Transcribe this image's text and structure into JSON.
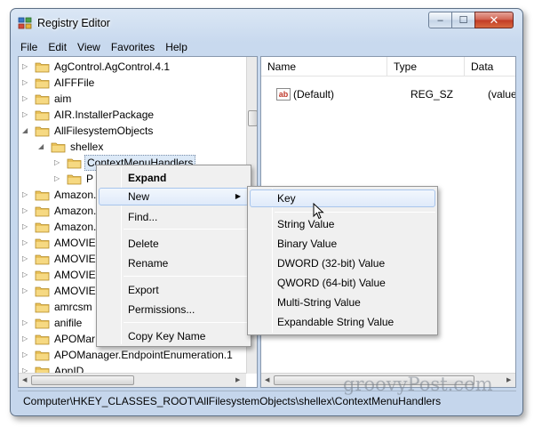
{
  "window": {
    "title": "Registry Editor",
    "min_symbol": "–",
    "max_symbol": "☐",
    "close_symbol": "✕"
  },
  "menubar": [
    "File",
    "Edit",
    "View",
    "Favorites",
    "Help"
  ],
  "tree": {
    "items": [
      {
        "label": "AgControl.AgControl.4.1",
        "expanded": false
      },
      {
        "label": "AIFFFile",
        "expanded": false
      },
      {
        "label": "aim",
        "expanded": false
      },
      {
        "label": "AIR.InstallerPackage",
        "expanded": false
      },
      {
        "label": "AllFilesystemObjects",
        "expanded": true
      },
      {
        "label": "shellex",
        "expanded": true
      },
      {
        "label": "ContextMenuHandlers",
        "selected": true
      },
      {
        "label": "P"
      },
      {
        "label": "Amazon."
      },
      {
        "label": "Amazon."
      },
      {
        "label": "Amazon."
      },
      {
        "label": "AMOVIE."
      },
      {
        "label": "AMOVIE."
      },
      {
        "label": "AMOVIE."
      },
      {
        "label": "AMOVIE."
      },
      {
        "label": "amrcsm"
      },
      {
        "label": "anifile"
      },
      {
        "label": "APOMar"
      },
      {
        "label": "APOManager.EndpointEnumeration.1"
      },
      {
        "label": "AppID"
      }
    ]
  },
  "list": {
    "columns": [
      "Name",
      "Type",
      "Data"
    ],
    "rows": [
      {
        "name": "(Default)",
        "type": "REG_SZ",
        "data": "(value n"
      }
    ]
  },
  "context_menu": {
    "items": [
      "Expand",
      "New",
      "Find...",
      "Delete",
      "Rename",
      "Export",
      "Permissions...",
      "Copy Key Name"
    ]
  },
  "submenu": {
    "items": [
      "Key",
      "String Value",
      "Binary Value",
      "DWORD (32-bit) Value",
      "QWORD (64-bit) Value",
      "Multi-String Value",
      "Expandable String Value"
    ]
  },
  "statusbar": {
    "path": "Computer\\HKEY_CLASSES_ROOT\\AllFilesystemObjects\\shellex\\ContextMenuHandlers"
  },
  "watermark": "groovyPost.com",
  "icons": {
    "ab_icon": "ab",
    "submenu_arrow": "▶"
  },
  "colors": {
    "folder": "#e9c15a",
    "selection": "#dce9f7",
    "menu_highlight": "#dfeafa"
  }
}
